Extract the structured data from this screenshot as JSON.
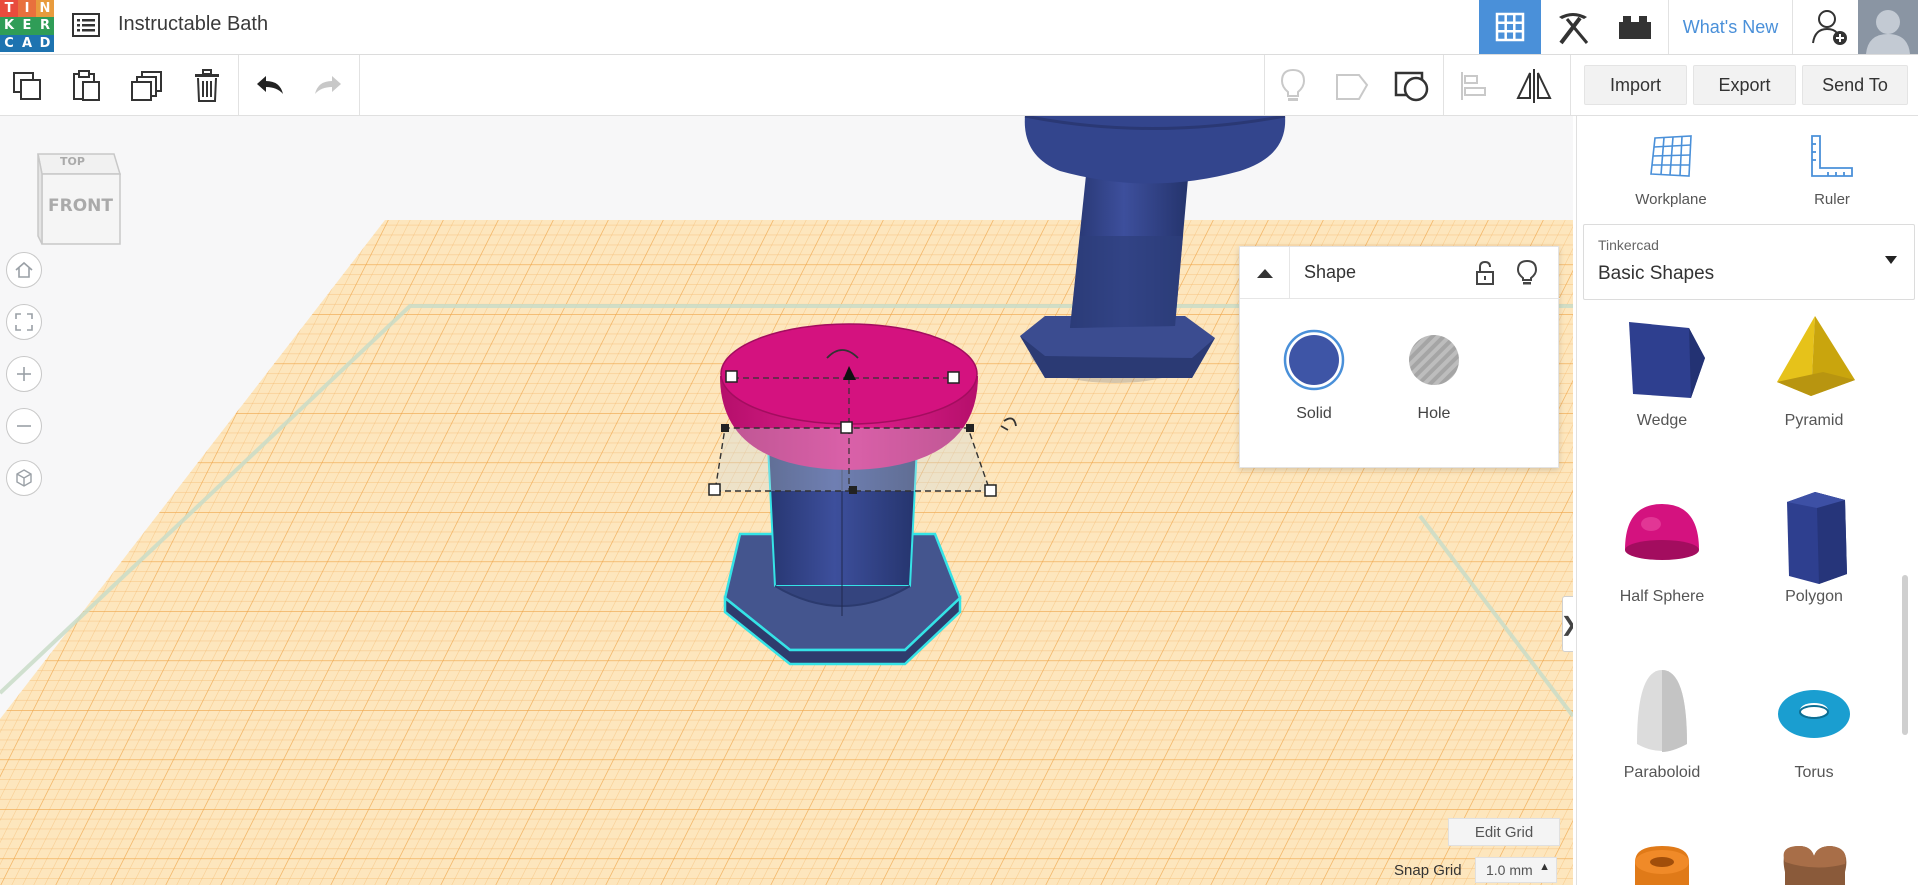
{
  "app": {
    "logo_letters": [
      "T",
      "I",
      "N",
      "K",
      "E",
      "R",
      "C",
      "A",
      "D"
    ],
    "logo_colors": [
      "#e84c3d",
      "#e8703d",
      "#e89b3d",
      "#2f9d57",
      "#2f9d57",
      "#2f9d57",
      "#1d73b0",
      "#1d73b0",
      "#1d73b0"
    ],
    "design_title": "Instructable Bath",
    "whats_new": "What's New"
  },
  "toolbar": {
    "icons": [
      "copy-icon",
      "paste-icon",
      "duplicate-icon",
      "delete-icon",
      "undo-icon",
      "redo-icon",
      "light-icon",
      "hide-icon",
      "group-icon",
      "align-icon",
      "mirror-icon"
    ],
    "import_label": "Import",
    "export_label": "Export",
    "send_to_label": "Send To"
  },
  "viewcube": {
    "top_label": "TOP",
    "front_label": "FRONT"
  },
  "nav_controls": [
    "home-icon",
    "fit-view-icon",
    "zoom-in-icon",
    "zoom-out-icon",
    "perspective-icon"
  ],
  "inspector": {
    "title": "Shape",
    "solid_label": "Solid",
    "hole_label": "Hole",
    "solid_color": "#3e55a6",
    "hole_color": "#b5b5b5"
  },
  "workplane": {
    "edit_grid_label": "Edit Grid",
    "snap_grid_label": "Snap Grid",
    "snap_grid_value": "1.0 mm",
    "grid_color": "#f6b85b",
    "grid_bg": "#fde9c4"
  },
  "panel": {
    "workplane_label": "Workplane",
    "ruler_label": "Ruler",
    "library_category": "Tinkercad",
    "library_value": "Basic Shapes",
    "shapes": [
      {
        "label": "Wedge",
        "color": "#2e3f8f"
      },
      {
        "label": "Pyramid",
        "color": "#e6c21a"
      },
      {
        "label": "Half Sphere",
        "color": "#d4127f"
      },
      {
        "label": "Polygon",
        "color": "#2e3f8f"
      },
      {
        "label": "Paraboloid",
        "color": "#d8d8d8"
      },
      {
        "label": "Torus",
        "color": "#1a9ed0"
      }
    ]
  }
}
